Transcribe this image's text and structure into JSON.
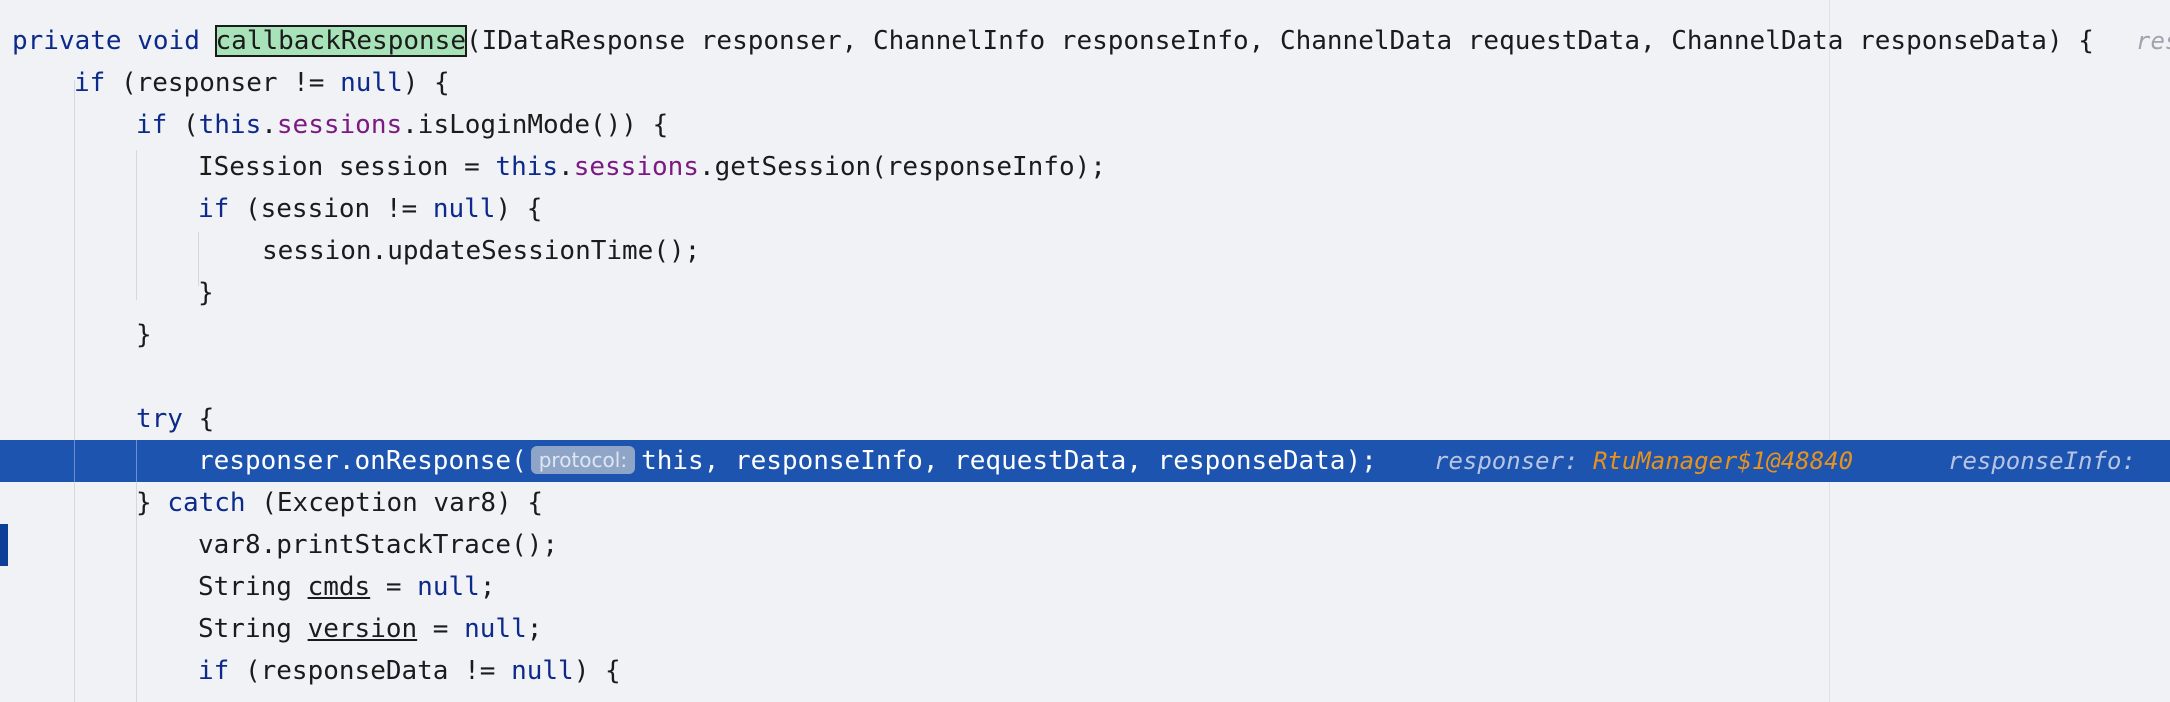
{
  "editor": {
    "lines": [
      {
        "id": "l1",
        "text_parts": [
          "private",
          " ",
          "void",
          " ",
          "callbackResponse",
          "(IDataResponse responser, ChannelInfo responseInfo, ChannelData requestData, ChannelData responseData) {"
        ],
        "trailing_hint": "res"
      },
      {
        "id": "l2",
        "text_parts": [
          "if",
          " (responser != ",
          "null",
          ") {"
        ]
      },
      {
        "id": "l3",
        "text_parts": [
          "if",
          " (",
          "this",
          ".",
          "sessions",
          ".isLoginMode()) {"
        ]
      },
      {
        "id": "l4",
        "text_parts": [
          "ISession session = ",
          "this",
          ".",
          "sessions",
          ".getSession(responseInfo);"
        ]
      },
      {
        "id": "l5",
        "text_parts": [
          "if",
          " (session != ",
          "null",
          ") {"
        ]
      },
      {
        "id": "l6",
        "text_parts": [
          "session.updateSessionTime();"
        ]
      },
      {
        "id": "l7",
        "text_parts": [
          "}"
        ]
      },
      {
        "id": "l8",
        "text_parts": [
          "}"
        ]
      },
      {
        "id": "l9",
        "text_parts": [
          ""
        ]
      },
      {
        "id": "l10",
        "text_parts": [
          "try",
          " {"
        ]
      },
      {
        "id": "l11",
        "text_parts": [
          "responser.onResponse(",
          "this, responseInfo, requestData, responseData);"
        ],
        "param_hint": "protocol:",
        "inline_values": [
          {
            "name": "responser:",
            "value": "RtuManager$1@48840"
          },
          {
            "name": "responseInfo:",
            "value": ""
          }
        ]
      },
      {
        "id": "l12",
        "text_parts": [
          "} ",
          "catch",
          " (Exception var8) {"
        ]
      },
      {
        "id": "l13",
        "text_parts": [
          "var8.printStackTrace();"
        ]
      },
      {
        "id": "l14",
        "text_parts": [
          "String ",
          "cmds",
          " = ",
          "null",
          ";"
        ]
      },
      {
        "id": "l15",
        "text_parts": [
          "String ",
          "version",
          " = ",
          "null",
          ";"
        ]
      },
      {
        "id": "l16",
        "text_parts": [
          "if",
          " (responseData != ",
          "null",
          ") {"
        ]
      }
    ]
  },
  "colors": {
    "background": "#f0f2f6",
    "keyword": "#0c2a8a",
    "field": "#7a1a82",
    "current_line": "#1d54b0",
    "inline_value": "#e8921e",
    "method_highlight": "#a8e2b8"
  }
}
